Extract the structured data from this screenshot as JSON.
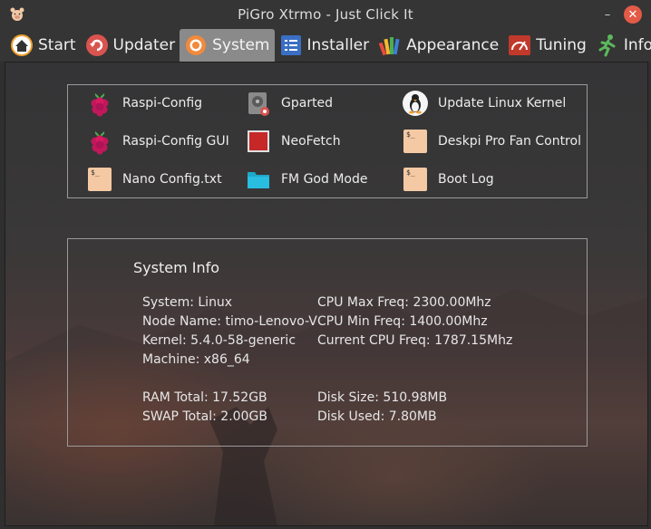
{
  "window": {
    "title": "PiGro Xtrmo - Just Click It",
    "min_glyph": "–",
    "close_glyph": "✕"
  },
  "tabs": [
    {
      "label": "Start",
      "icon": "home-icon"
    },
    {
      "label": "Updater",
      "icon": "refresh-icon"
    },
    {
      "label": "System",
      "icon": "gear-icon"
    },
    {
      "label": "Installer",
      "icon": "list-icon"
    },
    {
      "label": "Appearance",
      "icon": "palette-icon"
    },
    {
      "label": "Tuning",
      "icon": "speedometer-icon"
    },
    {
      "label": "Info",
      "icon": "running-man-icon"
    }
  ],
  "active_tab": "System",
  "launchers": [
    {
      "label": "Raspi-Config",
      "icon": "raspberry-icon"
    },
    {
      "label": "Gparted",
      "icon": "disk-icon"
    },
    {
      "label": "Update Linux Kernel",
      "icon": "tux-icon"
    },
    {
      "label": "Raspi-Config GUI",
      "icon": "raspberry-icon"
    },
    {
      "label": "NeoFetch",
      "icon": "neofetch-icon"
    },
    {
      "label": "Deskpi Pro Fan Control",
      "icon": "terminal-icon"
    },
    {
      "label": "Nano Config.txt",
      "icon": "terminal-icon"
    },
    {
      "label": "FM God Mode",
      "icon": "folder-icon"
    },
    {
      "label": "Boot Log",
      "icon": "terminal-icon"
    }
  ],
  "terminal_glyph": "$_",
  "system_info": {
    "title": "System Info",
    "system": "System: Linux",
    "node_name": "Node Name: timo-Lenovo-V",
    "kernel": "Kernel: 5.4.0-58-generic",
    "machine": "Machine: x86_64",
    "cpu_max": "CPU Max Freq: 2300.00Mhz",
    "cpu_min": "CPU Min Freq: 1400.00Mhz",
    "cpu_cur": "Current CPU Freq: 1787.15Mhz",
    "ram_total": "RAM Total: 17.52GB",
    "swap_total": "SWAP Total: 2.00GB",
    "disk_size": "Disk Size: 510.98MB",
    "disk_used": "Disk Used: 7.80MB"
  },
  "colors": {
    "active_tab_bg": "#8a8a8a",
    "close_button": "#e35a47",
    "terminal_icon": "#f4c9a3",
    "folder_icon": "#1fa8c9"
  }
}
